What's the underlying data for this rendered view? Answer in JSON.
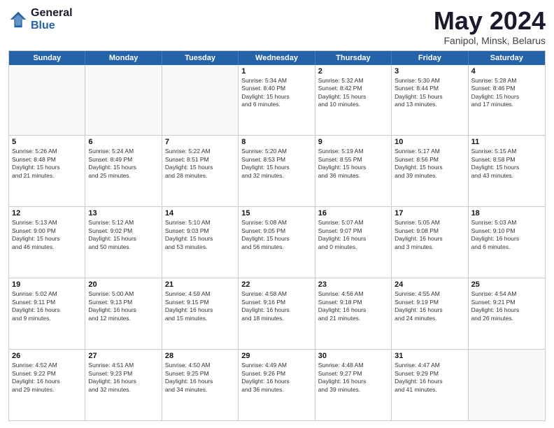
{
  "header": {
    "logo_general": "General",
    "logo_blue": "Blue",
    "title": "May 2024",
    "location": "Fanipol, Minsk, Belarus"
  },
  "weekdays": [
    "Sunday",
    "Monday",
    "Tuesday",
    "Wednesday",
    "Thursday",
    "Friday",
    "Saturday"
  ],
  "rows": [
    [
      {
        "day": "",
        "info": ""
      },
      {
        "day": "",
        "info": ""
      },
      {
        "day": "",
        "info": ""
      },
      {
        "day": "1",
        "info": "Sunrise: 5:34 AM\nSunset: 8:40 PM\nDaylight: 15 hours\nand 6 minutes."
      },
      {
        "day": "2",
        "info": "Sunrise: 5:32 AM\nSunset: 8:42 PM\nDaylight: 15 hours\nand 10 minutes."
      },
      {
        "day": "3",
        "info": "Sunrise: 5:30 AM\nSunset: 8:44 PM\nDaylight: 15 hours\nand 13 minutes."
      },
      {
        "day": "4",
        "info": "Sunrise: 5:28 AM\nSunset: 8:46 PM\nDaylight: 15 hours\nand 17 minutes."
      }
    ],
    [
      {
        "day": "5",
        "info": "Sunrise: 5:26 AM\nSunset: 8:48 PM\nDaylight: 15 hours\nand 21 minutes."
      },
      {
        "day": "6",
        "info": "Sunrise: 5:24 AM\nSunset: 8:49 PM\nDaylight: 15 hours\nand 25 minutes."
      },
      {
        "day": "7",
        "info": "Sunrise: 5:22 AM\nSunset: 8:51 PM\nDaylight: 15 hours\nand 28 minutes."
      },
      {
        "day": "8",
        "info": "Sunrise: 5:20 AM\nSunset: 8:53 PM\nDaylight: 15 hours\nand 32 minutes."
      },
      {
        "day": "9",
        "info": "Sunrise: 5:19 AM\nSunset: 8:55 PM\nDaylight: 15 hours\nand 36 minutes."
      },
      {
        "day": "10",
        "info": "Sunrise: 5:17 AM\nSunset: 8:56 PM\nDaylight: 15 hours\nand 39 minutes."
      },
      {
        "day": "11",
        "info": "Sunrise: 5:15 AM\nSunset: 8:58 PM\nDaylight: 15 hours\nand 43 minutes."
      }
    ],
    [
      {
        "day": "12",
        "info": "Sunrise: 5:13 AM\nSunset: 9:00 PM\nDaylight: 15 hours\nand 46 minutes."
      },
      {
        "day": "13",
        "info": "Sunrise: 5:12 AM\nSunset: 9:02 PM\nDaylight: 15 hours\nand 50 minutes."
      },
      {
        "day": "14",
        "info": "Sunrise: 5:10 AM\nSunset: 9:03 PM\nDaylight: 15 hours\nand 53 minutes."
      },
      {
        "day": "15",
        "info": "Sunrise: 5:08 AM\nSunset: 9:05 PM\nDaylight: 15 hours\nand 56 minutes."
      },
      {
        "day": "16",
        "info": "Sunrise: 5:07 AM\nSunset: 9:07 PM\nDaylight: 16 hours\nand 0 minutes."
      },
      {
        "day": "17",
        "info": "Sunrise: 5:05 AM\nSunset: 9:08 PM\nDaylight: 16 hours\nand 3 minutes."
      },
      {
        "day": "18",
        "info": "Sunrise: 5:03 AM\nSunset: 9:10 PM\nDaylight: 16 hours\nand 6 minutes."
      }
    ],
    [
      {
        "day": "19",
        "info": "Sunrise: 5:02 AM\nSunset: 9:11 PM\nDaylight: 16 hours\nand 9 minutes."
      },
      {
        "day": "20",
        "info": "Sunrise: 5:00 AM\nSunset: 9:13 PM\nDaylight: 16 hours\nand 12 minutes."
      },
      {
        "day": "21",
        "info": "Sunrise: 4:59 AM\nSunset: 9:15 PM\nDaylight: 16 hours\nand 15 minutes."
      },
      {
        "day": "22",
        "info": "Sunrise: 4:58 AM\nSunset: 9:16 PM\nDaylight: 16 hours\nand 18 minutes."
      },
      {
        "day": "23",
        "info": "Sunrise: 4:56 AM\nSunset: 9:18 PM\nDaylight: 16 hours\nand 21 minutes."
      },
      {
        "day": "24",
        "info": "Sunrise: 4:55 AM\nSunset: 9:19 PM\nDaylight: 16 hours\nand 24 minutes."
      },
      {
        "day": "25",
        "info": "Sunrise: 4:54 AM\nSunset: 9:21 PM\nDaylight: 16 hours\nand 26 minutes."
      }
    ],
    [
      {
        "day": "26",
        "info": "Sunrise: 4:52 AM\nSunset: 9:22 PM\nDaylight: 16 hours\nand 29 minutes."
      },
      {
        "day": "27",
        "info": "Sunrise: 4:51 AM\nSunset: 9:23 PM\nDaylight: 16 hours\nand 32 minutes."
      },
      {
        "day": "28",
        "info": "Sunrise: 4:50 AM\nSunset: 9:25 PM\nDaylight: 16 hours\nand 34 minutes."
      },
      {
        "day": "29",
        "info": "Sunrise: 4:49 AM\nSunset: 9:26 PM\nDaylight: 16 hours\nand 36 minutes."
      },
      {
        "day": "30",
        "info": "Sunrise: 4:48 AM\nSunset: 9:27 PM\nDaylight: 16 hours\nand 39 minutes."
      },
      {
        "day": "31",
        "info": "Sunrise: 4:47 AM\nSunset: 9:29 PM\nDaylight: 16 hours\nand 41 minutes."
      },
      {
        "day": "",
        "info": ""
      }
    ]
  ]
}
